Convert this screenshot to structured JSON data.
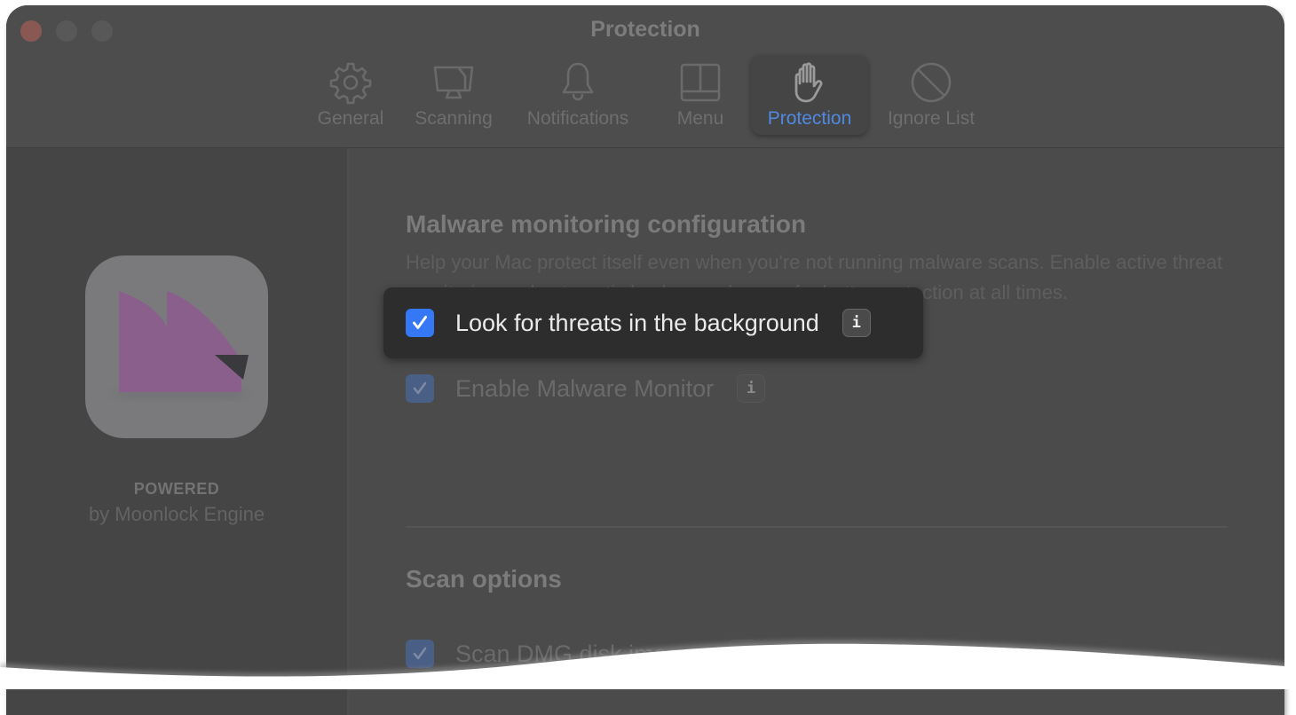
{
  "window": {
    "title": "Protection",
    "traffic_lights": [
      "close",
      "minimize",
      "maximize"
    ]
  },
  "toolbar": {
    "tabs": [
      {
        "label": "General",
        "icon": "gear-icon",
        "active": false
      },
      {
        "label": "Scanning",
        "icon": "monitor-scan-icon",
        "active": false
      },
      {
        "label": "Notifications",
        "icon": "bell-icon",
        "active": false
      },
      {
        "label": "Menu",
        "icon": "menu-layout-icon",
        "active": false
      },
      {
        "label": "Protection",
        "icon": "hand-stop-icon",
        "active": true
      },
      {
        "label": "Ignore List",
        "icon": "prohibited-icon",
        "active": false
      }
    ],
    "accent_color": "#4f8ae0"
  },
  "sidebar": {
    "app_icon": "moonlock-logo",
    "powered_label": "POWERED",
    "engine_label": "by Moonlock Engine"
  },
  "main": {
    "section1": {
      "title": "Malware monitoring configuration",
      "description": "Help your Mac protect itself even when you're not running malware scans. Enable active threat monitoring and automatic background scans for better protection at all times.",
      "options": [
        {
          "label": "Enable Malware Monitor",
          "checked": true,
          "info": "i"
        },
        {
          "label": "Look for threats in the background",
          "checked": true,
          "info": "i",
          "highlighted": true
        }
      ]
    },
    "section2": {
      "title": "Scan options",
      "options": [
        {
          "label": "Scan DMG disk images",
          "checked": true
        }
      ]
    }
  },
  "colors": {
    "checkbox_on": "#3478f6",
    "window_bg": "#4b4b4b"
  }
}
